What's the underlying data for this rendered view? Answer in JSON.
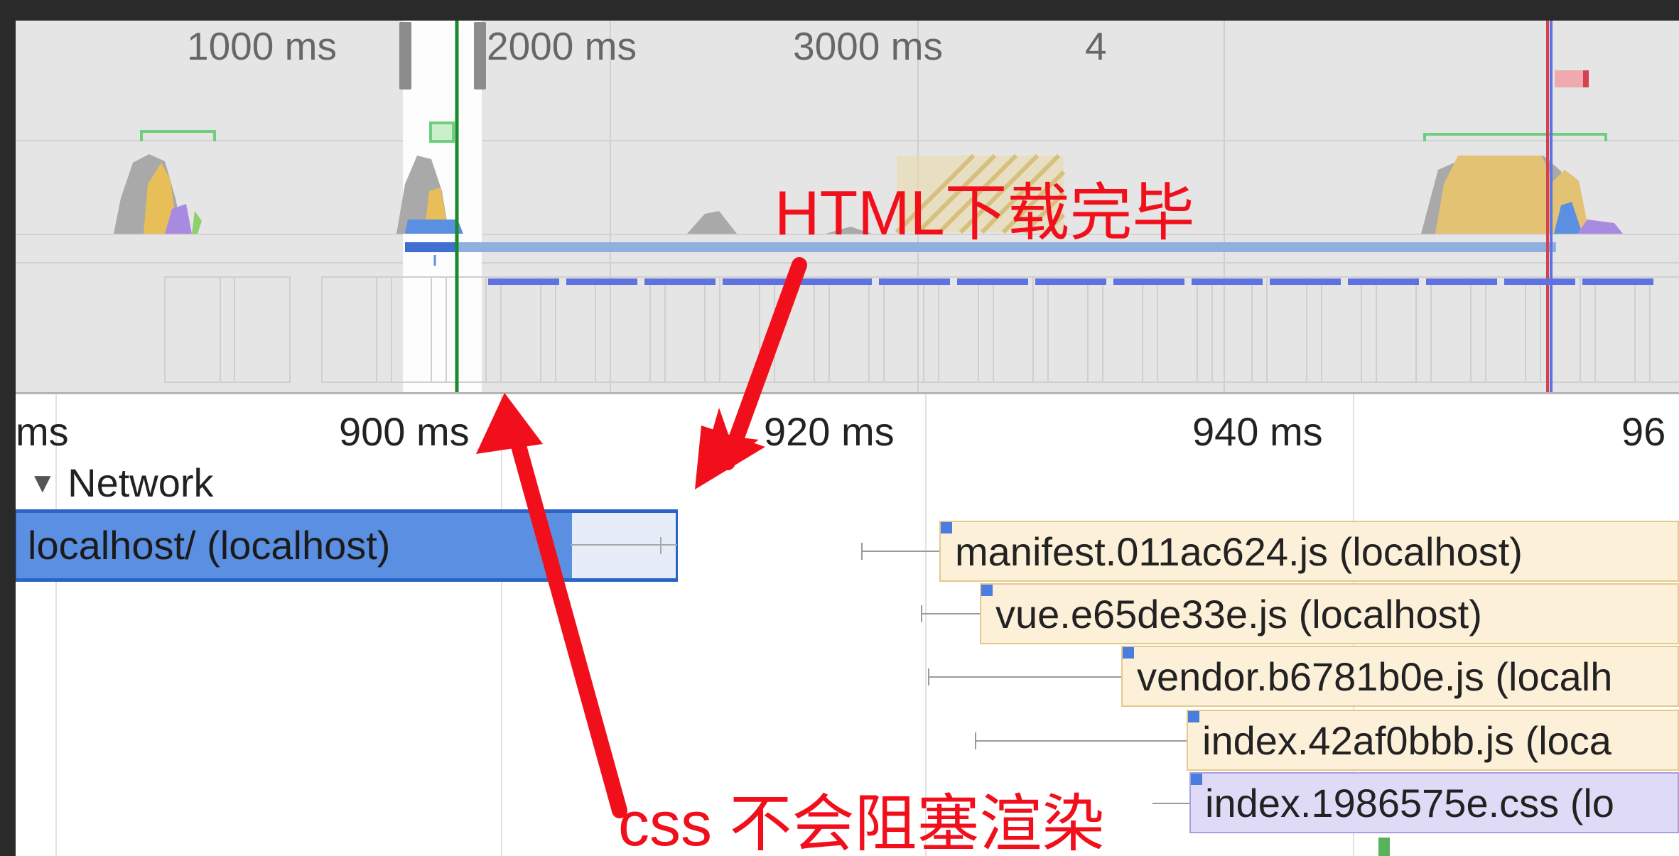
{
  "overview": {
    "ticks": [
      "1000 ms",
      "2000 ms",
      "3000 ms",
      "4"
    ]
  },
  "detail": {
    "ruler": [
      "ms",
      "900 ms",
      "920 ms",
      "940 ms",
      "96"
    ]
  },
  "network": {
    "section_label": "Network",
    "requests": [
      {
        "label": "localhost/ (localhost)",
        "type": "document"
      },
      {
        "label": "manifest.011ac624.js (localhost)",
        "type": "script"
      },
      {
        "label": "vue.e65de33e.js (localhost)",
        "type": "script"
      },
      {
        "label": "vendor.b6781b0e.js (localh",
        "type": "script"
      },
      {
        "label": "index.42af0bbb.js (loca",
        "type": "script"
      },
      {
        "label": "index.1986575e.css (lo",
        "type": "stylesheet"
      }
    ]
  },
  "annotations": {
    "html_done": "HTML下载完毕",
    "css_note": "css 不会阻塞渲染"
  },
  "colors": {
    "annotation": "#f20f1c",
    "document": "#5b8fe1",
    "script": "#fcf0d9",
    "stylesheet": "#dfdbf7",
    "timeline_red": "#d64150",
    "timeline_green": "#1a8a2a"
  }
}
